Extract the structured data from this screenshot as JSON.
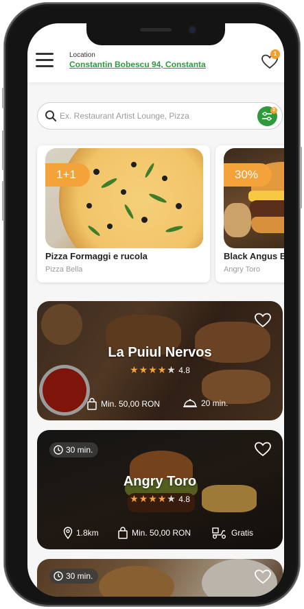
{
  "header": {
    "location_label": "Location",
    "location_value": "Constantin Bobescu 94, Constanta",
    "favorites_count": "1"
  },
  "search": {
    "placeholder": "Ex. Restaurant Artist Lounge, Pizza",
    "filter_count": "3"
  },
  "deals": [
    {
      "badge": "1+1",
      "title": "Pizza Formaggi e rucola",
      "restaurant": "Pizza Bella"
    },
    {
      "badge": "30%",
      "title": "Black Angus B",
      "restaurant": "Angry Toro"
    }
  ],
  "restaurants": [
    {
      "name": "La Puiul Nervos",
      "rating": "4.8",
      "stars": 4,
      "min_order": "Min. 50,00 RON",
      "delivery_time": "20 min."
    },
    {
      "name": "Angry Toro",
      "rating": "4.8",
      "stars": 4,
      "time": "30 min.",
      "distance": "1.8km",
      "min_order": "Min. 50,00 RON",
      "delivery_fee": "Gratis"
    },
    {
      "time": "30 min."
    }
  ],
  "colors": {
    "brand_green": "#2e9a3c",
    "accent_orange": "#f4a23a"
  }
}
